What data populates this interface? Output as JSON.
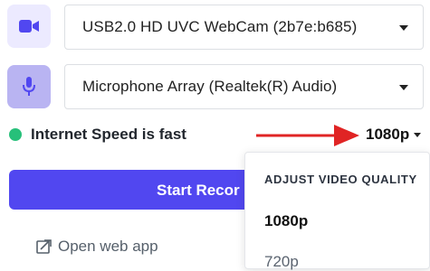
{
  "camera": {
    "icon": "video-camera-icon",
    "selected": "USB2.0 HD UVC WebCam (2b7e:b685)"
  },
  "microphone": {
    "icon": "microphone-icon",
    "selected": "Microphone Array (Realtek(R) Audio)"
  },
  "status": {
    "text": "Internet Speed is fast",
    "color": "#27c07a"
  },
  "quality": {
    "current": "1080p",
    "menu_heading": "ADJUST VIDEO QUALITY",
    "options": [
      "1080p",
      "720p"
    ]
  },
  "start_button": {
    "label": "Start Recor",
    "color": "#5147f0"
  },
  "open_web_app": {
    "label": "Open web app",
    "icon": "external-link-icon"
  },
  "annotation": {
    "arrow_color": "#e02424"
  }
}
